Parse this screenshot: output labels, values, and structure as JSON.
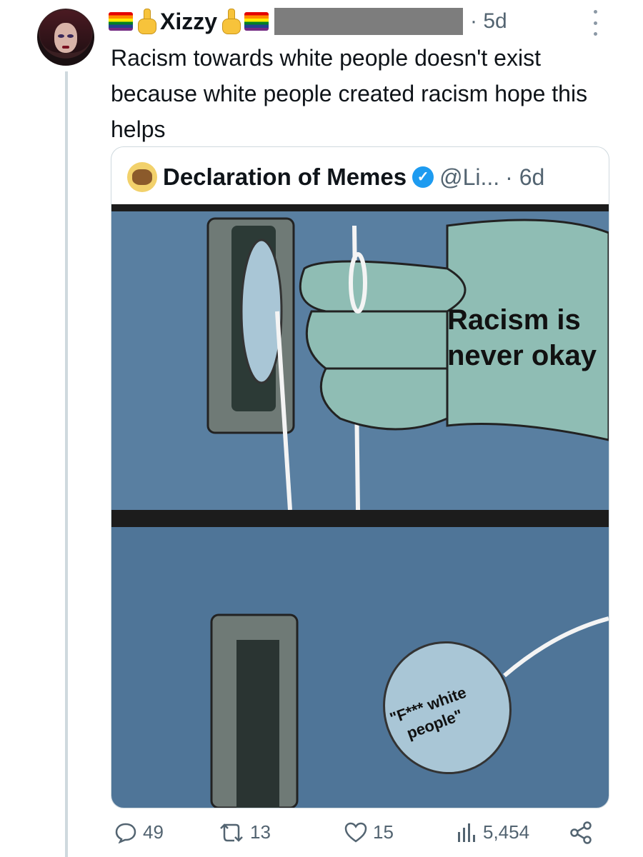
{
  "author": {
    "name": "Xizzy",
    "time": "· 5d"
  },
  "tweet": {
    "text": "Racism towards white people doesn't exist because white people created racism hope this helps"
  },
  "quote": {
    "name": "Declaration of Memes",
    "handle": "@Li...",
    "time": "· 6d",
    "meme": {
      "top_caption_line1": "Racism is",
      "top_caption_line2": "never okay",
      "bottom_caption_line1": "\"F*** white",
      "bottom_caption_line2": "people\""
    }
  },
  "actions": {
    "replies": "49",
    "reposts": "13",
    "likes": "15",
    "views": "5,454"
  },
  "colors": {
    "verified": "#1d9bf0",
    "muted_text": "#536471"
  }
}
